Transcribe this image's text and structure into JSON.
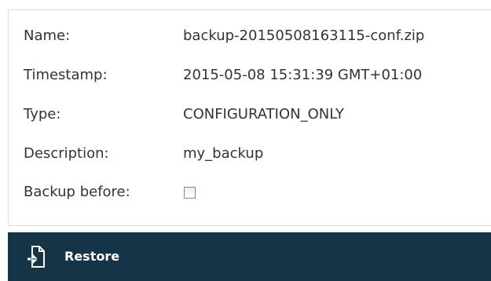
{
  "details": {
    "name": {
      "label": "Name:",
      "value": "backup-20150508163115-conf.zip"
    },
    "timestamp": {
      "label": "Timestamp:",
      "value": "2015-05-08 15:31:39 GMT+01:00"
    },
    "type": {
      "label": "Type:",
      "value": "CONFIGURATION_ONLY"
    },
    "description": {
      "label": "Description:",
      "value": "my_backup"
    },
    "backup_before": {
      "label": "Backup before:",
      "checked": false
    }
  },
  "actions": {
    "restore": {
      "label": "Restore",
      "icon": "restore-icon"
    }
  },
  "colors": {
    "action_bar": "#153447",
    "border": "#dcdcdc",
    "text": "#333333"
  }
}
